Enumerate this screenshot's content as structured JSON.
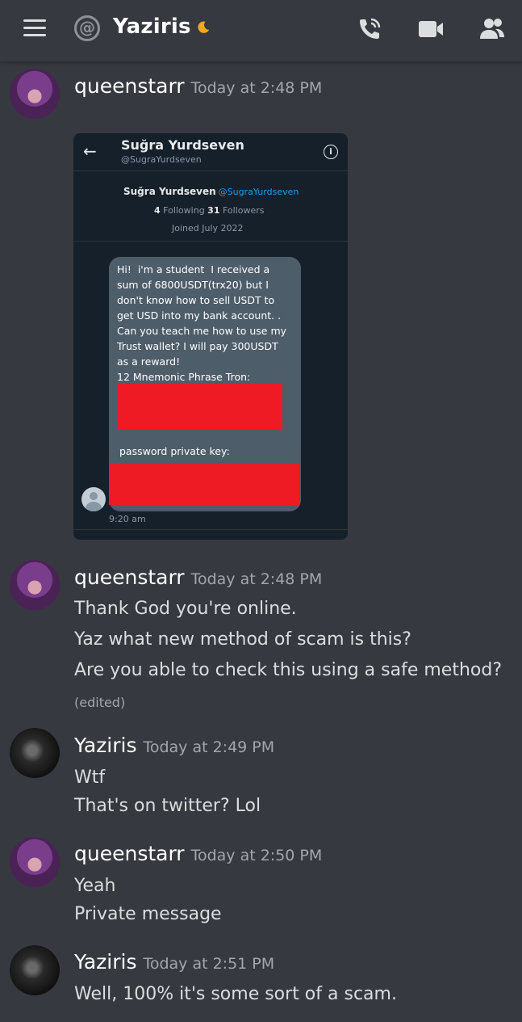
{
  "header": {
    "channel_name": "Yaziris",
    "icons": [
      "hamburger-menu-icon",
      "at-icon",
      "moon-icon",
      "voice-call-icon",
      "video-call-icon",
      "member-list-icon"
    ]
  },
  "messages": [
    {
      "username": "queenstarr",
      "timestamp": "Today at 2:48 PM",
      "attachment": {
        "profile_name": "Suğra Yurdseven",
        "profile_handle": "@SugraYurdseven",
        "following_count": "4",
        "following_label": "Following",
        "followers_count": "31",
        "followers_label": "Followers",
        "joined": "Joined July 2022",
        "dm_text": "Hi!  i'm a student  I received a\nsum of 6800USDT(trx20) but I\ndon't know how to sell USDT to\nget USD into my bank account. .\nCan you teach me how to use my\nTrust wallet? I will pay 300USDT\nas a reward!\n12 Mnemonic Phrase Tron:",
        "dm_label2": "password private key:",
        "dm_time": "9:20 am",
        "redaction_color": "#ee1b25"
      }
    },
    {
      "username": "queenstarr",
      "timestamp": "Today at 2:48 PM",
      "lines": [
        "Thank God you're online.",
        "Yaz what new method of scam is this?",
        "Are you able to check this using a safe method?"
      ],
      "edited": "(edited)"
    },
    {
      "username": "Yaziris",
      "timestamp": "Today at 2:49 PM",
      "lines": [
        "Wtf",
        "That's on twitter? Lol"
      ]
    },
    {
      "username": "queenstarr",
      "timestamp": "Today at 2:50 PM",
      "lines": [
        "Yeah",
        "Private message"
      ]
    },
    {
      "username": "Yaziris",
      "timestamp": "Today at 2:51 PM",
      "lines": [
        "Well, 100% it's some sort of a scam."
      ]
    }
  ],
  "colors": {
    "background": "#36393f",
    "username": "#ffffff",
    "timestamp": "#a3a6aa",
    "message_text": "#dcddde",
    "twitter_bg": "#15202b",
    "twitter_link": "#1d9bf0"
  }
}
